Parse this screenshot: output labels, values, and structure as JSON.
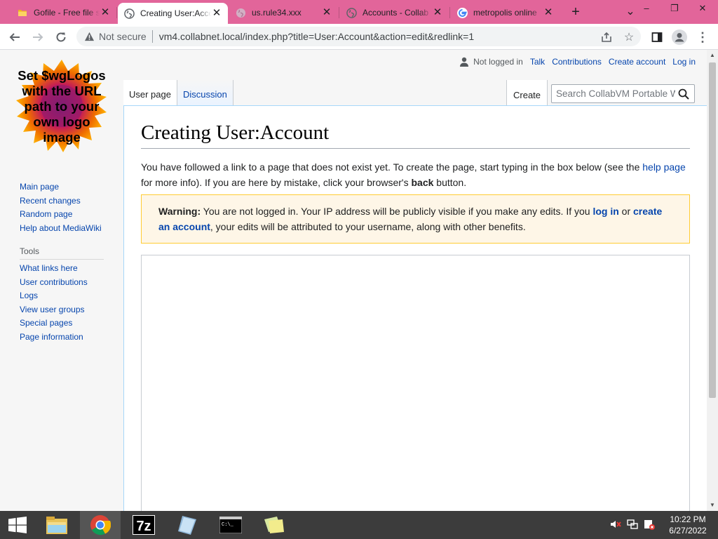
{
  "browser": {
    "tabs": [
      {
        "title": "Gofile - Free file s",
        "icon": "folder-favicon",
        "active": false
      },
      {
        "title": "Creating User:Acco",
        "icon": "globe-favicon",
        "active": true
      },
      {
        "title": "us.rule34.xxx",
        "icon": "globe-favicon",
        "active": false
      },
      {
        "title": "Accounts - Collab",
        "icon": "globe-favicon",
        "active": false
      },
      {
        "title": "metropolis online",
        "icon": "google-favicon",
        "active": false
      }
    ],
    "new_tab_symbol": "+",
    "tab_search_symbol": "⌄",
    "window_controls": [
      "–",
      "❐",
      "✕"
    ],
    "security_label": "Not secure",
    "url": "vm4.collabnet.local/index.php?title=User:Account&action=edit&redlink=1"
  },
  "wiki": {
    "logo_text": "Set $wgLogos with the URL path to your own logo image",
    "personal": {
      "not_logged_in": "Not logged in",
      "talk": "Talk",
      "contributions": "Contributions",
      "create_account": "Create account",
      "log_in": "Log in"
    },
    "tabs": {
      "user_page": "User page",
      "discussion": "Discussion",
      "create": "Create"
    },
    "search_placeholder": "Search CollabVM Portable W",
    "navigation": [
      "Main page",
      "Recent changes",
      "Random page",
      "Help about MediaWiki"
    ],
    "tools_heading": "Tools",
    "tools": [
      "What links here",
      "User contributions",
      "Logs",
      "View user groups",
      "Special pages",
      "Page information"
    ],
    "heading": "Creating User:Account",
    "intro": {
      "part1": "You have followed a link to a page that does not exist yet. To create the page, start typing in the box below (see the ",
      "help_link": "help page",
      "part2": " for more info). If you are here by mistake, click your browser's ",
      "back": "back",
      "part3": " button."
    },
    "warning": {
      "label": "Warning:",
      "part1": " You are not logged in. Your IP address will be publicly visible if you make any edits. If you ",
      "log_in_link": "log in",
      "part2": " or ",
      "create_link": "create an account",
      "part3": ", your edits will be attributed to your username, along with other benefits."
    }
  },
  "taskbar": {
    "time": "10:22 PM",
    "date": "6/27/2022",
    "apps": [
      "file-explorer-icon",
      "chrome-icon",
      "7zip-icon",
      "notepad-icon",
      "cmd-icon",
      "sticky-notes-icon"
    ]
  },
  "colors": {
    "tabstrip": "#e2659a",
    "link": "#0645ad",
    "warning_bg": "#fef6e7",
    "warning_border": "#ffcc33",
    "taskbar": "#3c3c3c"
  }
}
